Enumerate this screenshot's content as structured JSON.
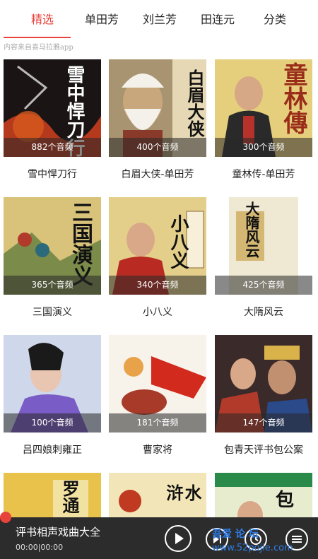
{
  "tabs": [
    {
      "label": "精选",
      "active": true
    },
    {
      "label": "单田芳",
      "active": false
    },
    {
      "label": "刘兰芳",
      "active": false
    },
    {
      "label": "田连元",
      "active": false
    },
    {
      "label": "分类",
      "active": false
    }
  ],
  "source_note": "内容来自喜马拉雅app",
  "cards": [
    {
      "title": "雪中悍刀行",
      "count": "882个音频",
      "cover_text": "雪中悍刀行"
    },
    {
      "title": "白眉大侠-单田芳",
      "count": "400个音频",
      "cover_text": "白眉大侠"
    },
    {
      "title": "童林传-单田芳",
      "count": "300个音频",
      "cover_text": "童林傳"
    },
    {
      "title": "三国演义",
      "count": "365个音频",
      "cover_text": "三国演义"
    },
    {
      "title": "小八义",
      "count": "340个音频",
      "cover_text": "小八义"
    },
    {
      "title": "大隋风云",
      "count": "425个音频",
      "cover_text": "大隋风云"
    },
    {
      "title": "吕四娘刺雍正",
      "count": "100个音频",
      "cover_text": ""
    },
    {
      "title": "曹家将",
      "count": "181个音频",
      "cover_text": ""
    },
    {
      "title": "包青天评书包公案",
      "count": "147个音频",
      "cover_text": ""
    },
    {
      "title": "",
      "count": "",
      "cover_text": "罗通"
    },
    {
      "title": "",
      "count": "",
      "cover_text": "水浒"
    },
    {
      "title": "",
      "count": "",
      "cover_text": "包"
    }
  ],
  "player": {
    "title": "评书相声戏曲大全",
    "time": "00:00|00:00",
    "icons": [
      "play-icon",
      "next-icon",
      "history-icon",
      "playlist-icon"
    ]
  },
  "watermark": {
    "line1": "吾爱 论 坛",
    "line2": "www.52pojie.com"
  },
  "colors": {
    "accent": "#e8433b",
    "player_bg": "#2c2c2c"
  }
}
